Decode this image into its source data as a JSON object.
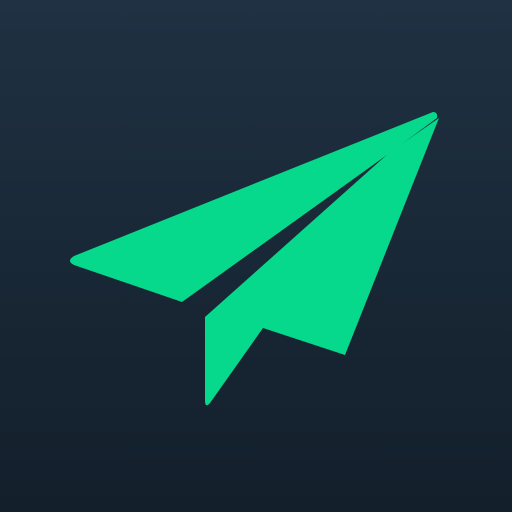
{
  "icon": {
    "name": "paper-plane-icon",
    "colors": {
      "background_top": "#1f3142",
      "background_bottom": "#131f2b",
      "plane": "#06d98c"
    }
  }
}
